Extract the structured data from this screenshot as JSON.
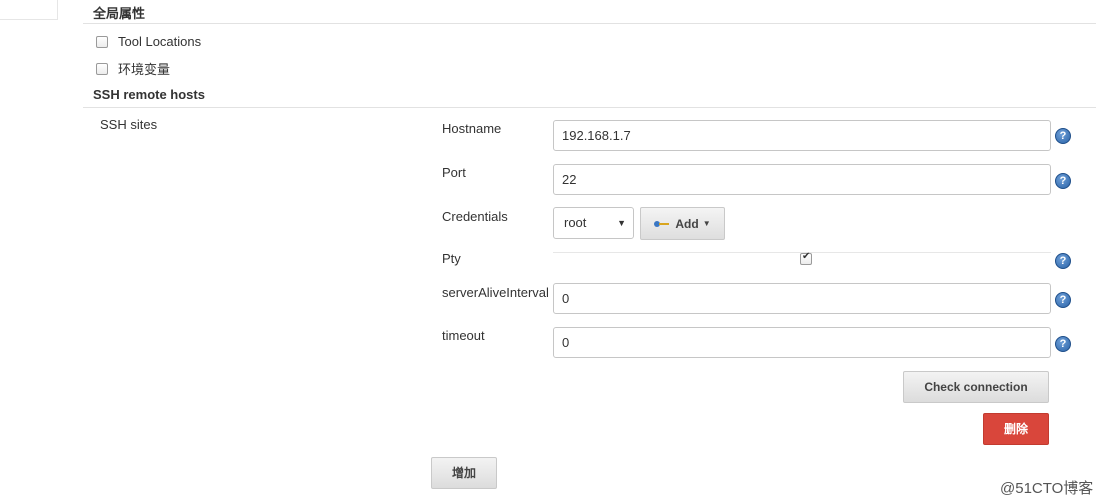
{
  "global_props": {
    "title": "全局属性",
    "tool_locations_label": "Tool Locations",
    "env_vars_label": "环境变量"
  },
  "ssh_section": {
    "title": "SSH remote hosts",
    "sites_label": "SSH sites"
  },
  "fields": {
    "hostname_label": "Hostname",
    "hostname_value": "192.168.1.7",
    "port_label": "Port",
    "port_value": "22",
    "credentials_label": "Credentials",
    "credentials_value": "root",
    "add_label": "Add",
    "pty_label": "Pty",
    "pty_checked": true,
    "server_alive_label": "serverAliveInterval",
    "server_alive_value": "0",
    "timeout_label": "timeout",
    "timeout_value": "0"
  },
  "help_icon_glyph": "?",
  "buttons": {
    "check_connection": "Check connection",
    "delete": "删除",
    "add_site": "增加"
  },
  "colors": {
    "delete_bg": "#d9463b",
    "help_blue": "#2a63a8"
  },
  "watermark": "@51CTO博客"
}
